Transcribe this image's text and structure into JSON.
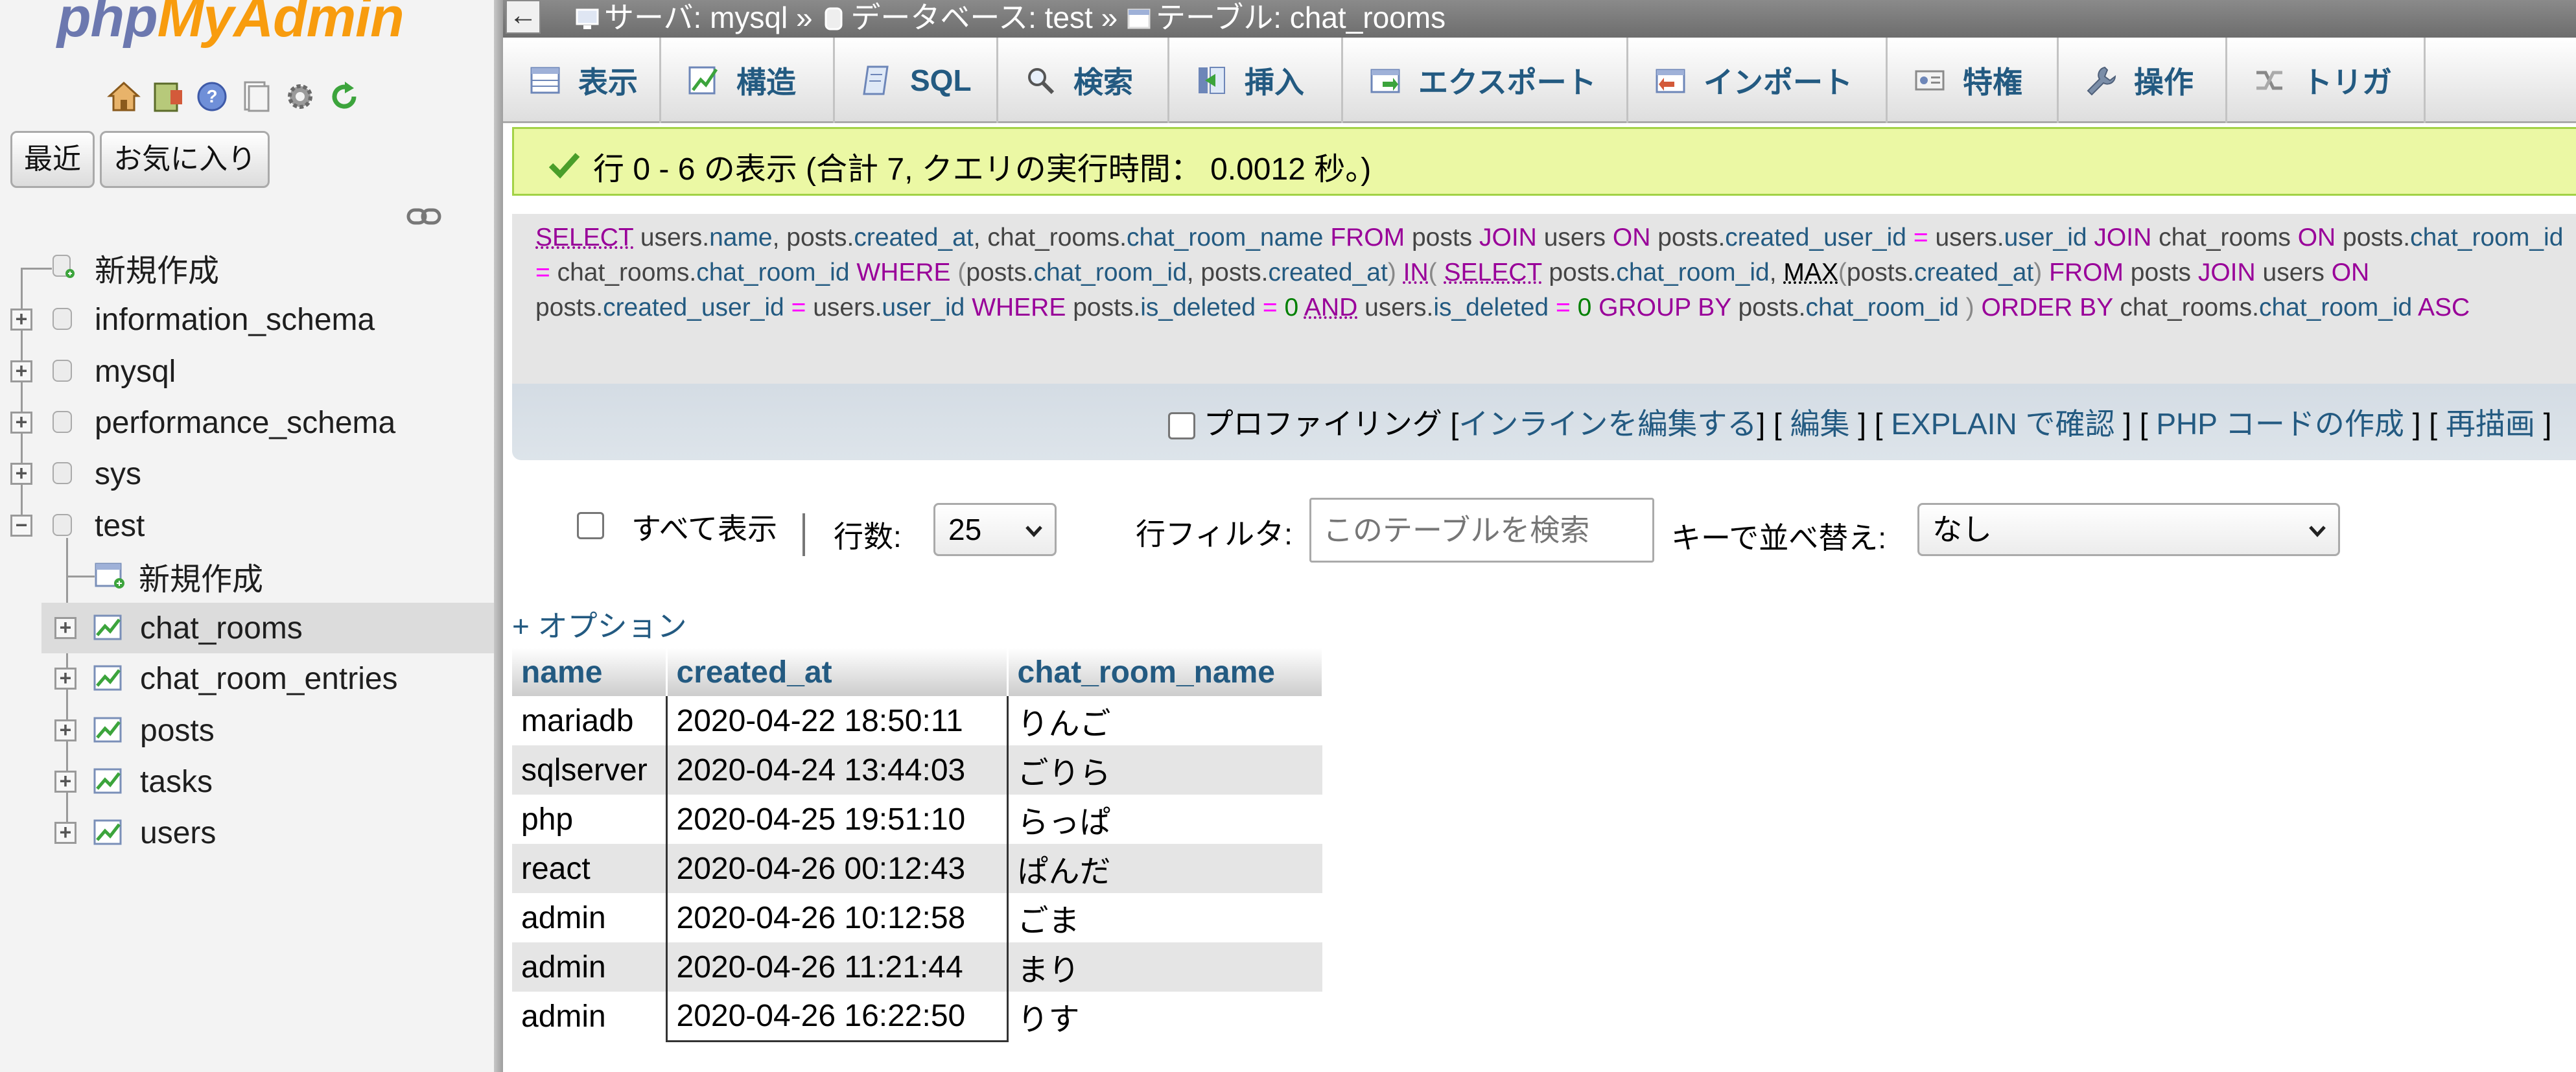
{
  "nav": {
    "logo_php": "php",
    "logo_myadmin": "MyAdmin",
    "icons": [
      "home-icon",
      "exit-icon",
      "help-icon",
      "docs-icon",
      "settings-icon",
      "reload-icon"
    ],
    "buttons": {
      "recent": "最近",
      "favorites": "お気に入り"
    },
    "tree": [
      {
        "label": "新規作成",
        "type": "new"
      },
      {
        "label": "information_schema",
        "type": "db"
      },
      {
        "label": "mysql",
        "type": "db"
      },
      {
        "label": "performance_schema",
        "type": "db"
      },
      {
        "label": "sys",
        "type": "db"
      },
      {
        "label": "test",
        "type": "db",
        "expanded": true
      },
      {
        "label": "新規作成",
        "type": "new-table"
      },
      {
        "label": "chat_rooms",
        "type": "table",
        "selected": true
      },
      {
        "label": "chat_room_entries",
        "type": "table"
      },
      {
        "label": "posts",
        "type": "table"
      },
      {
        "label": "tasks",
        "type": "table"
      },
      {
        "label": "users",
        "type": "table"
      }
    ]
  },
  "breadcrumb": {
    "server": "サーバ: mysql",
    "sep1": "»",
    "database": "データベース: test",
    "sep2": "»",
    "table": "テーブル: chat_rooms"
  },
  "tabs": [
    {
      "label": "表示",
      "icon": "browse-icon"
    },
    {
      "label": "構造",
      "icon": "structure-icon"
    },
    {
      "label": "SQL",
      "icon": "sql-icon"
    },
    {
      "label": "検索",
      "icon": "search-icon"
    },
    {
      "label": "挿入",
      "icon": "insert-icon"
    },
    {
      "label": "エクスポート",
      "icon": "export-icon"
    },
    {
      "label": "インポート",
      "icon": "import-icon"
    },
    {
      "label": "特権",
      "icon": "privileges-icon"
    },
    {
      "label": "操作",
      "icon": "operations-icon"
    },
    {
      "label": "トリガ",
      "icon": "triggers-icon"
    }
  ],
  "success_message": "行 0 - 6 の表示 (合計 7, クエリの実行時間： 0.0012 秒。)",
  "sql_actions": {
    "profiling": "プロファイリング",
    "inline_edit": "インラインを編集する",
    "edit": "編集",
    "explain": "EXPLAIN で確認",
    "php_code": "PHP コードの作成",
    "refresh": "再描画"
  },
  "filters": {
    "show_all": "すべて表示",
    "rows_label": "行数:",
    "rows_value": "25",
    "filter_label": "行フィルタ:",
    "filter_placeholder": "このテーブルを検索",
    "sort_label": "キーで並べ替え:",
    "sort_value": "なし"
  },
  "options_link": "+ オプション",
  "results": {
    "columns": [
      "name",
      "created_at",
      "chat_room_name"
    ],
    "rows": [
      [
        "mariadb",
        "2020-04-22 18:50:11",
        "りんご"
      ],
      [
        "sqlserver",
        "2020-04-24 13:44:03",
        "ごりら"
      ],
      [
        "php",
        "2020-04-25 19:51:10",
        "らっぱ"
      ],
      [
        "react",
        "2020-04-26 00:12:43",
        "ぱんだ"
      ],
      [
        "admin",
        "2020-04-26 10:12:58",
        "ごま"
      ],
      [
        "admin",
        "2020-04-26 11:21:44",
        "まり"
      ],
      [
        "admin",
        "2020-04-26 16:22:50",
        "りす"
      ]
    ]
  },
  "colors": {
    "link": "#235a81",
    "success_bg": "#ebf8a4",
    "sql_keyword": "#990099",
    "sql_operator": "#ff00ff",
    "sql_number": "#008000"
  }
}
